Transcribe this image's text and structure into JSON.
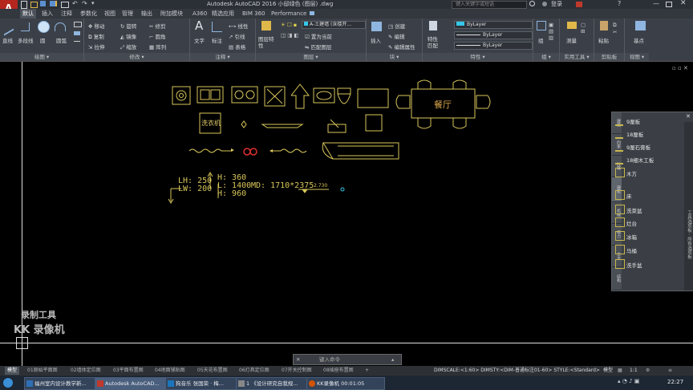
{
  "window": {
    "title": "Autodesk AutoCAD 2016   小邸绿色 (图层) .dwg",
    "search_placeholder": "键入关键字或短语",
    "login": "登录",
    "quick_access": [
      "新建",
      "打开",
      "保存",
      "另存为",
      "打印",
      "放弃",
      "重做"
    ],
    "app_button": "A"
  },
  "ribbon_tabs": [
    "默认",
    "插入",
    "注释",
    "参数化",
    "视图",
    "管理",
    "输出",
    "附加模块",
    "A360",
    "精选应用",
    "BIM 360",
    "Performance"
  ],
  "ribbon": {
    "draw": {
      "label": "绘图",
      "items": [
        "直线",
        "多段线",
        "圆",
        "圆弧"
      ]
    },
    "modify": {
      "label": "修改",
      "items": [
        "移动",
        "旋转",
        "修剪",
        "复制",
        "镜像",
        "圆角",
        "拉伸",
        "缩放",
        "阵列"
      ]
    },
    "annotation": {
      "label": "注释",
      "items": [
        "文字",
        "标注",
        "线性",
        "引线",
        "表格"
      ]
    },
    "layers": {
      "label": "图层",
      "items": [
        "图层特性",
        "置为当前",
        "匹配图层"
      ],
      "current_layer": "A-土建墙 (含楼开..."
    },
    "block": {
      "label": "块",
      "items": [
        "插入",
        "创建",
        "编辑",
        "编辑属性"
      ]
    },
    "properties": {
      "label": "特性",
      "items": [
        "特性匹配"
      ],
      "color": "ByLayer",
      "linetype": "ByLayer",
      "lineweight": "ByLayer"
    },
    "groups": {
      "label": "组",
      "items": [
        "组"
      ]
    },
    "utilities": {
      "label": "实用工具",
      "items": [
        "测量"
      ]
    },
    "clipboard": {
      "label": "剪贴板",
      "items": [
        "粘贴"
      ]
    },
    "view": {
      "label": "视图",
      "items": [
        "基点"
      ]
    }
  },
  "drawing": {
    "dining_label": "餐厅",
    "washer_label": "洗衣机",
    "dims": {
      "lh": "LH: 250",
      "lw": "LW: 200",
      "h1": "H: 360",
      "l1": "L: 1400",
      "md": "MD: 1710*2375",
      "h2": "H: 960",
      "elev": "2.730"
    }
  },
  "palette": {
    "items": [
      "9厘板",
      "18厘板",
      "9厘石膏板",
      "18细木工板",
      "木方",
      "床",
      "洗菜盆",
      "灶台",
      "冰箱",
      "马桶",
      "洗手盆"
    ],
    "side_tabs": [
      "建模",
      "约束",
      "注释",
      "建筑",
      "机械",
      "电力",
      "土木",
      "结构"
    ],
    "vertical_title": "工具选项板 - 所有选项板"
  },
  "watermark": {
    "line1": "录制工具",
    "line2": "KK 录像机"
  },
  "command_line": {
    "placeholder": "键入命令"
  },
  "layout_tabs": [
    "模型",
    "01原始平面图",
    "02墙体定位图",
    "03平面布置图",
    "04地面铺贴图",
    "05天花布置图",
    "06灯具定位图",
    "07开关控制图",
    "08插座布置图"
  ],
  "status_bar": {
    "info": "DIMSCALE:<1:60> DIMSTY:<DIM-普通标注01-60> STYLE:<Standard>",
    "model": "模型",
    "scale": "1:1",
    "time": "22:27"
  },
  "taskbar": {
    "items": [
      {
        "label": "福州室内设计教学新...",
        "color": "#2e6fb5"
      },
      {
        "label": "Autodesk AutoCAD...",
        "color": "#c0392b"
      },
      {
        "label": "狗音乐 张国荣 · 梅...",
        "color": "#1b75bb"
      },
      {
        "label": "1 《设计研究自我规...",
        "color": "#888"
      },
      {
        "label": "KK录像机 00:01:05",
        "color": "#d35400"
      }
    ]
  },
  "colors": {
    "drawing_yellow": "#d8c65a",
    "accent_blue": "#8fb6e0",
    "red_symbol": "#e03030",
    "layer_swatch": "#35c8e8"
  }
}
